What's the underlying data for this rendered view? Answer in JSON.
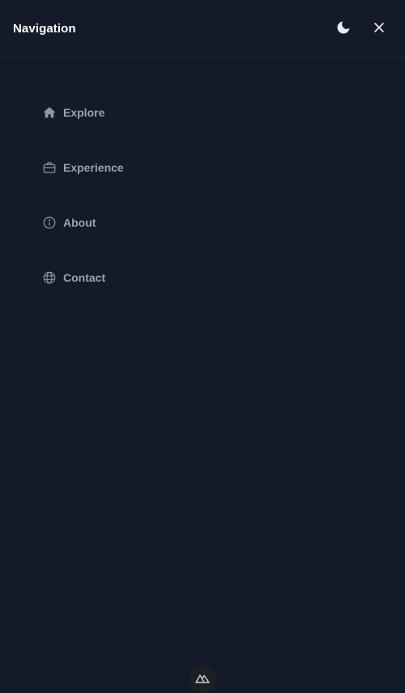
{
  "header": {
    "title": "Navigation",
    "theme_icon": "moon-icon",
    "close_icon": "close-icon"
  },
  "nav": {
    "items": [
      {
        "label": "Explore",
        "icon": "home-icon"
      },
      {
        "label": "Experience",
        "icon": "briefcase-icon"
      },
      {
        "label": "About",
        "icon": "info-icon"
      },
      {
        "label": "Contact",
        "icon": "globe-icon"
      }
    ]
  },
  "footer": {
    "logo_icon": "nuxt-logo-icon"
  },
  "colors": {
    "background": "#131a28",
    "title": "#ffffff",
    "nav_text": "#9aa3b2",
    "divider": "#222a3a"
  }
}
